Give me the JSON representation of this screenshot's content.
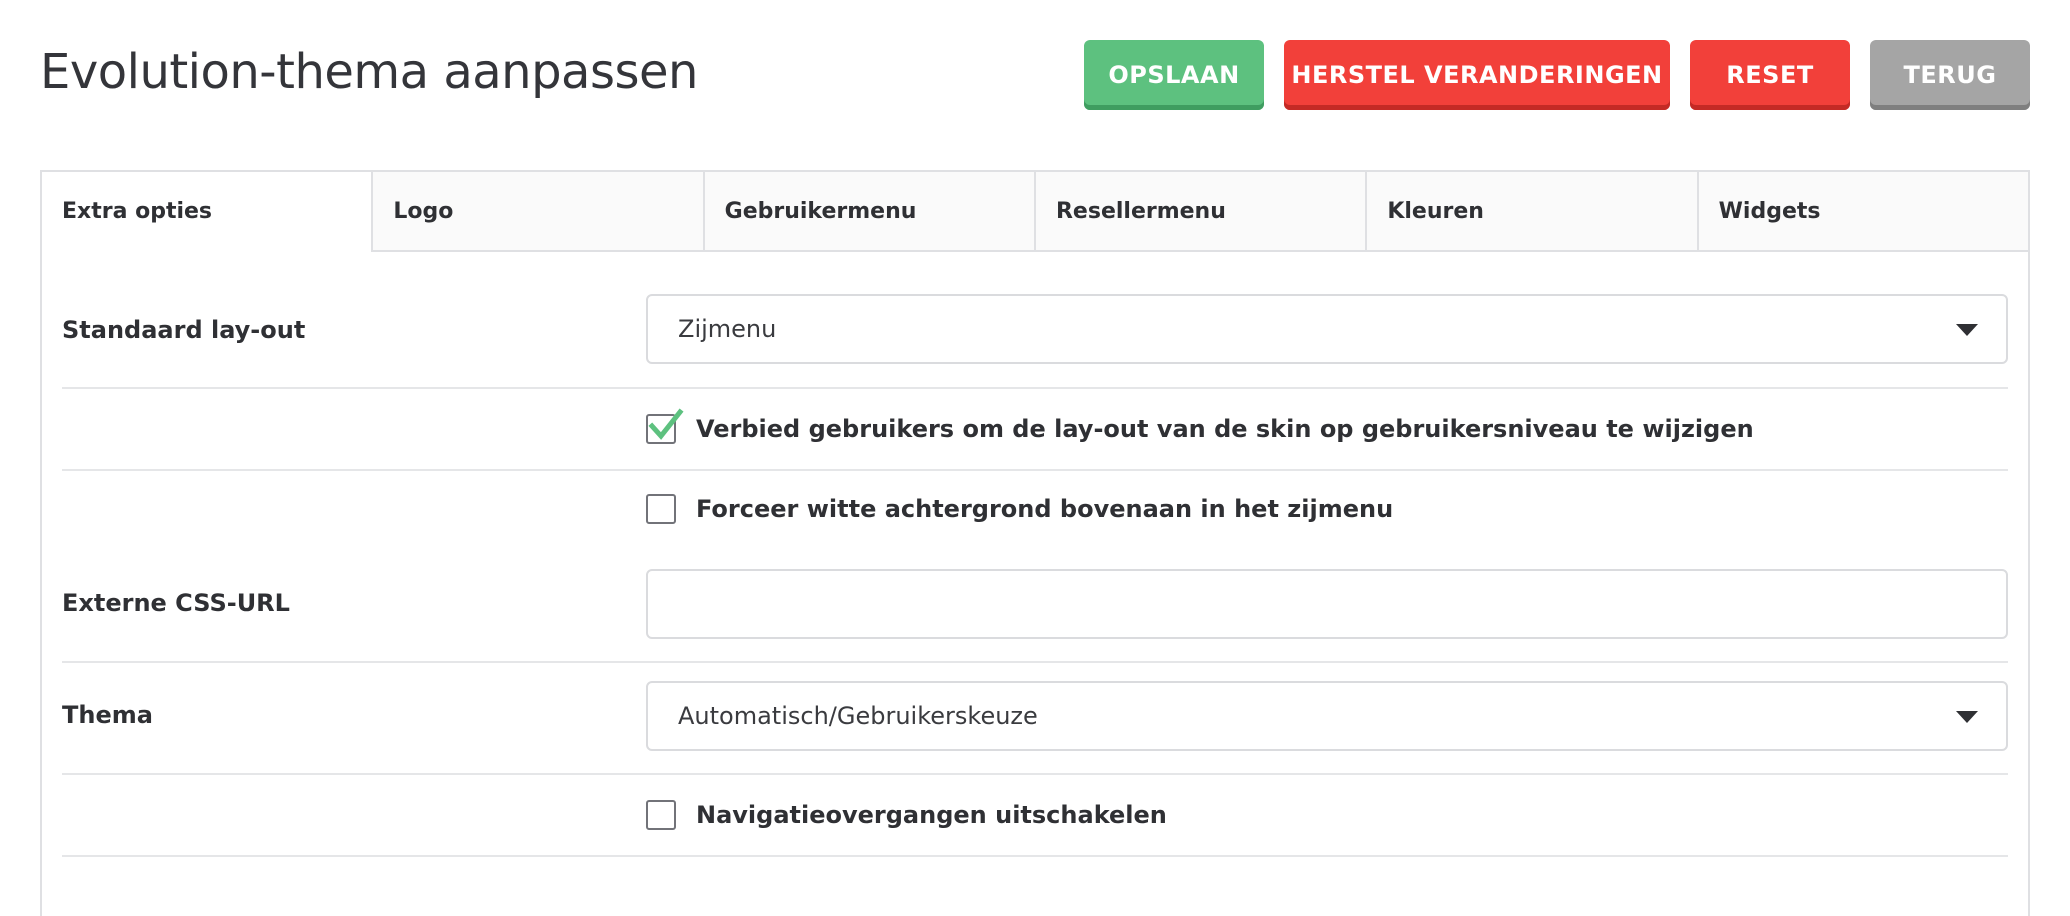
{
  "header": {
    "title": "Evolution-thema aanpassen",
    "buttons": {
      "save": "OPSLAAN",
      "undo": "HERSTEL VERANDERINGEN",
      "reset": "RESET",
      "back": "TERUG"
    }
  },
  "tabs": [
    {
      "label": "Extra opties",
      "active": true
    },
    {
      "label": "Logo",
      "active": false
    },
    {
      "label": "Gebruikermenu",
      "active": false
    },
    {
      "label": "Resellermenu",
      "active": false
    },
    {
      "label": "Kleuren",
      "active": false
    },
    {
      "label": "Widgets",
      "active": false
    }
  ],
  "form": {
    "layout": {
      "label": "Standaard lay-out",
      "value": "Zijmenu"
    },
    "forbid_layout_change": {
      "label": "Verbied gebruikers om de lay-out van de skin op gebruikersniveau te wijzigen",
      "checked": true
    },
    "force_white_bg": {
      "label": "Forceer witte achtergrond bovenaan in het zijmenu",
      "checked": false
    },
    "external_css": {
      "label": "Externe CSS-URL",
      "value": ""
    },
    "theme": {
      "label": "Thema",
      "value": "Automatisch/Gebruikerskeuze"
    },
    "disable_transitions": {
      "label": "Navigatieovergangen uitschakelen",
      "checked": false
    }
  },
  "colors": {
    "save": "#5dc17f",
    "danger": "#f2403a",
    "neutral": "#a5a5a5",
    "check": "#5dc17f"
  },
  "icons": {
    "select_caret": "chevron-down-icon",
    "checkmark": "checkmark-icon"
  }
}
